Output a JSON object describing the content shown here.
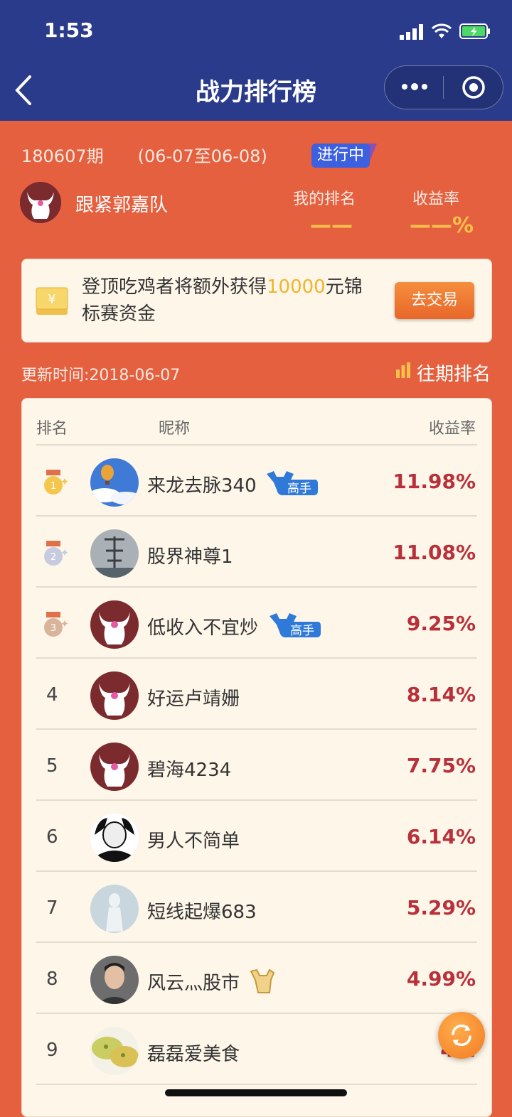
{
  "status_bar": {
    "time": "1:53"
  },
  "nav": {
    "title": "战力排行榜"
  },
  "period": {
    "label": "180607期　　(06-07至06-08)",
    "status": "进行中"
  },
  "me": {
    "name": "跟紧郭嘉队",
    "rank_label": "我的排名",
    "rank_value": "——",
    "yield_label": "收益率",
    "yield_value": "——%"
  },
  "banner": {
    "text_before": "登顶吃鸡者将额外获得",
    "amount": "10000",
    "text_after": "元锦标赛资金",
    "button": "去交易"
  },
  "update": {
    "text": "更新时间:2018-06-07",
    "past_link": "往期排名"
  },
  "table": {
    "headers": {
      "rank": "排名",
      "nickname": "昵称",
      "yield": "收益率"
    },
    "rows": [
      {
        "rank": "1",
        "name": "来龙去脉340",
        "yield": "11.98%",
        "badge": "高手"
      },
      {
        "rank": "2",
        "name": "股界神尊1",
        "yield": "11.08%"
      },
      {
        "rank": "3",
        "name": "低收入不宜炒",
        "yield": "9.25%",
        "badge": "高手"
      },
      {
        "rank": "4",
        "name": "好运卢靖姗",
        "yield": "8.14%"
      },
      {
        "rank": "5",
        "name": "碧海4234",
        "yield": "7.75%"
      },
      {
        "rank": "6",
        "name": "男人不简单",
        "yield": "6.14%"
      },
      {
        "rank": "7",
        "name": "短线起爆683",
        "yield": "5.29%"
      },
      {
        "rank": "8",
        "name": "风云灬股市",
        "yield": "4.99%"
      },
      {
        "rank": "9",
        "name": "磊磊爱美食",
        "yield": "4.2"
      }
    ]
  },
  "colors": {
    "navy": "#2a3b8c",
    "page": "#e5603f",
    "rate_red": "#b8303a",
    "gold": "#f0b42d"
  }
}
